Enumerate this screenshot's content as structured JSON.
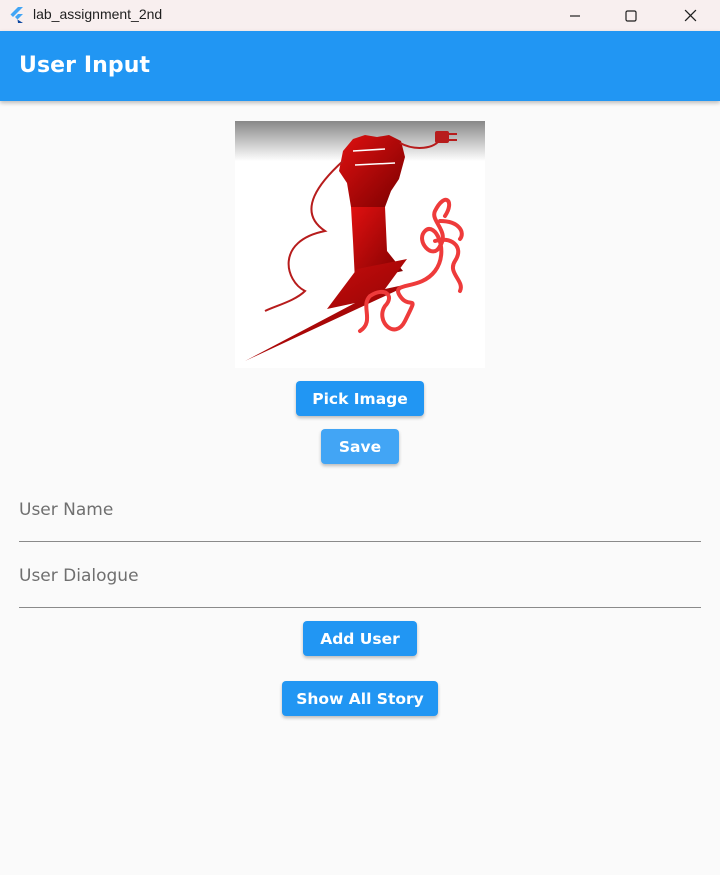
{
  "window": {
    "title": "lab_assignment_2nd",
    "controls": {
      "minimize": "minimize-icon",
      "maximize": "maximize-icon",
      "close": "close-icon"
    }
  },
  "appbar": {
    "title": "User Input"
  },
  "buttons": {
    "pick_image": "Pick Image",
    "save": "Save",
    "add_user": "Add User",
    "show_all_story": "Show All Story"
  },
  "fields": {
    "user_name": {
      "placeholder": "User Name",
      "value": ""
    },
    "user_dialogue": {
      "placeholder": "User Dialogue",
      "value": ""
    }
  },
  "colors": {
    "primary": "#2196f3",
    "save_button": "#42a5f5",
    "background": "#fafafa",
    "titlebar": "#f8efef"
  }
}
